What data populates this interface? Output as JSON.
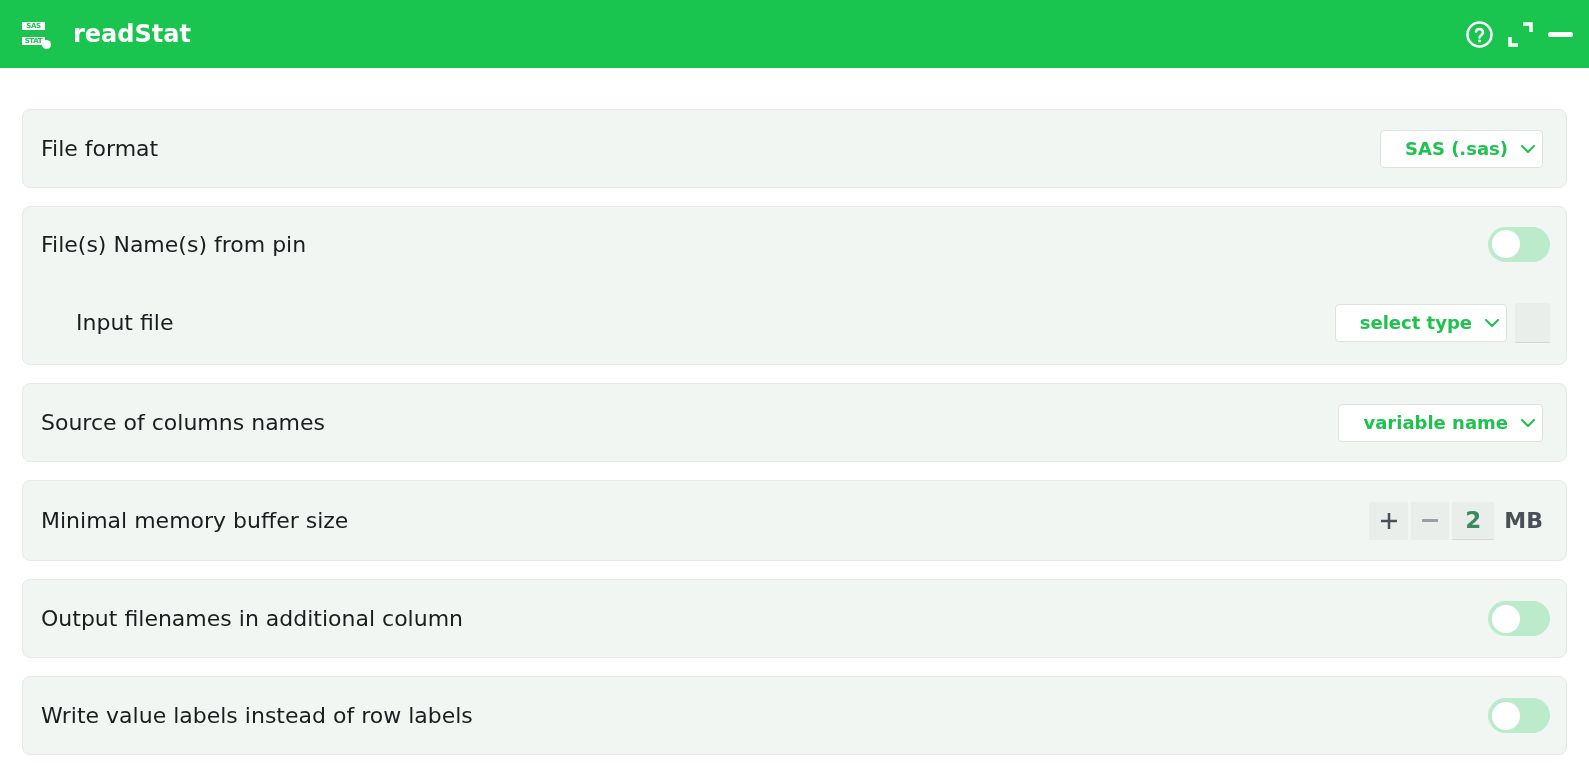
{
  "header": {
    "title": "readStat",
    "logo_lines": [
      "SAS",
      "STAT"
    ]
  },
  "settings": [
    {
      "kind": "select",
      "label": "File format",
      "value": "SAS (.sas)"
    },
    {
      "kind": "toggle",
      "label": "File(s) Name(s) from pin",
      "on": false,
      "children": [
        {
          "kind": "select_pin",
          "label": "Input file",
          "value": "select type"
        }
      ]
    },
    {
      "kind": "select",
      "label": "Source of columns names",
      "value": "variable name"
    },
    {
      "kind": "number",
      "label": "Minimal memory buffer size",
      "value": "2",
      "unit": "MB",
      "decrement_disabled": true
    },
    {
      "kind": "toggle",
      "label": "Output filenames in additional column",
      "on": false
    },
    {
      "kind": "toggle",
      "label": "Write value labels instead of row labels",
      "on": false
    }
  ]
}
